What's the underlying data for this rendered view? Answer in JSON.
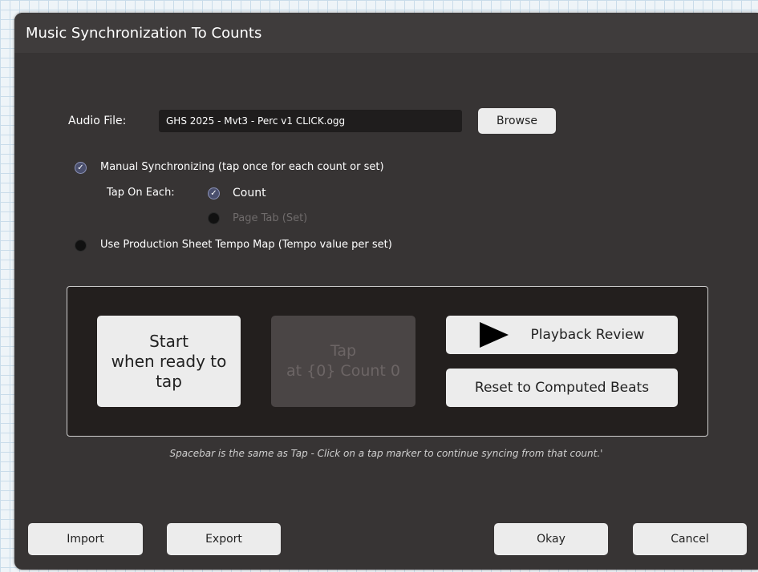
{
  "dialog": {
    "title": "Music Synchronization To Counts"
  },
  "audio": {
    "label": "Audio File:",
    "value": "GHS 2025 - Mvt3 - Perc v1 CLICK.ogg",
    "browse_label": "Browse"
  },
  "options": {
    "manual_label": "Manual Synchronizing (tap once for each count or set)",
    "manual_checked": true,
    "tap_on_each_label": "Tap On Each:",
    "count_label": "Count",
    "count_checked": true,
    "page_tab_label": "Page Tab (Set)",
    "page_tab_checked": false,
    "tempo_map_label": "Use Production Sheet Tempo Map (Tempo value per set)",
    "tempo_map_checked": false
  },
  "sync": {
    "start_line1": "Start",
    "start_line2": "when ready to",
    "start_line3": "tap",
    "tap_line1": "Tap",
    "tap_line2": "at {0} Count 0",
    "playback_label": "Playback Review",
    "reset_label": "Reset to Computed Beats"
  },
  "hint": "Spacebar is the same as Tap  -   Click on a tap marker to continue syncing from that count.'",
  "footer": {
    "import_label": "Import",
    "export_label": "Export",
    "okay_label": "Okay",
    "cancel_label": "Cancel"
  },
  "colors": {
    "dialog_bg": "#373434",
    "panel_bg": "#231f1e",
    "button_bg": "#ececec",
    "disabled_button_bg": "#4a4545",
    "radio_checked": "#4a4f6d"
  }
}
